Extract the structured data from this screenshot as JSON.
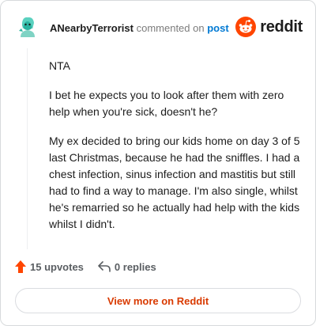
{
  "comment": {
    "author": "ANearbyTerrorist",
    "action_text": "commented on",
    "post_link": "post",
    "paragraphs": [
      "NTA",
      "I bet he expects you to look after them with zero help when you're sick, doesn't he?",
      "My ex decided to bring our kids home on day 3 of 5 last Christmas, because he had the sniffles. I had a chest infection, sinus infection and mastitis but still had to find a way to manage. I'm also single, whilst he's remarried so he actually had help with the kids whilst I didn't."
    ]
  },
  "brand": {
    "name": "reddit",
    "accent": "#ff4500"
  },
  "actions": {
    "upvotes": "15 upvotes",
    "replies": "0 replies",
    "upvote_icon": "upvote-arrow-icon",
    "reply_icon": "reply-arrow-icon"
  },
  "view_more": "View more on Reddit"
}
